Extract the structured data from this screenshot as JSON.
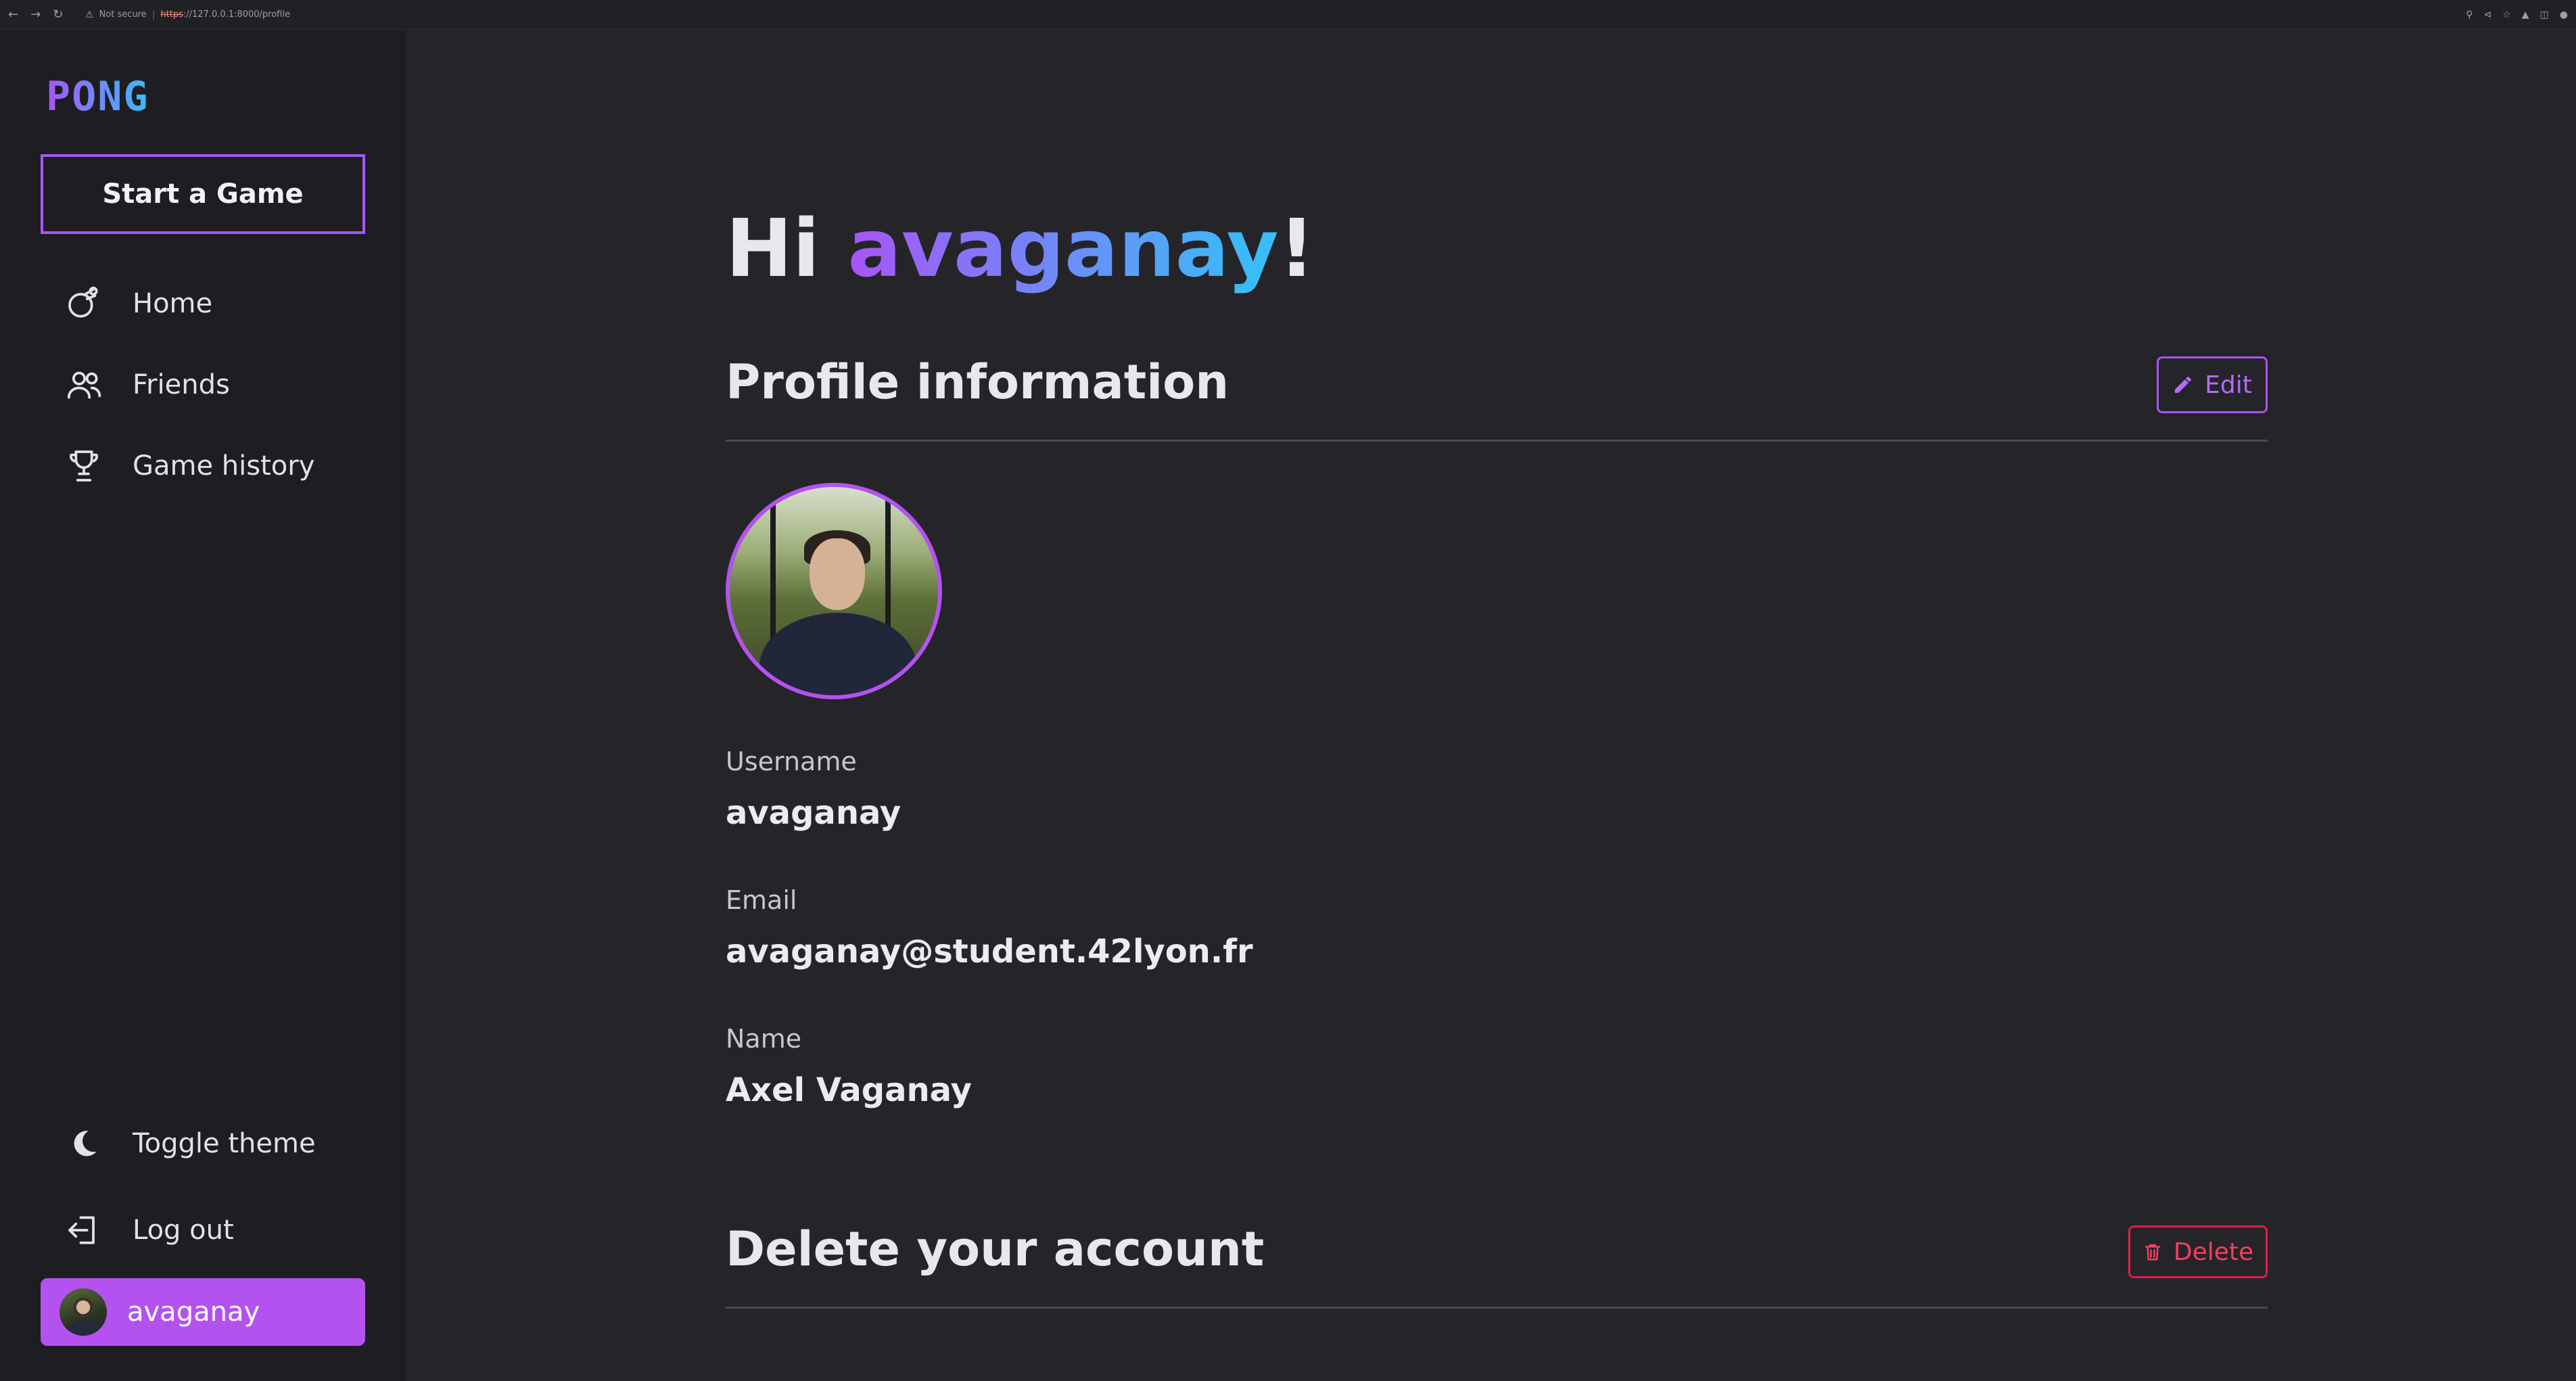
{
  "browser": {
    "security": "Not secure",
    "url_scheme": "https",
    "url_rest": "://127.0.0.1:8000/profile"
  },
  "sidebar": {
    "logo": "PONG",
    "start_button": "Start a Game",
    "items": [
      {
        "label": "Home",
        "icon": "home-icon"
      },
      {
        "label": "Friends",
        "icon": "friends-icon"
      },
      {
        "label": "Game history",
        "icon": "trophy-icon"
      }
    ],
    "toggle_theme": "Toggle theme",
    "logout": "Log out",
    "profile_name": "avaganay"
  },
  "main": {
    "greeting_prefix": "Hi ",
    "greeting_user": "avaganay",
    "greeting_suffix": "!",
    "profile_section_title": "Profile information",
    "edit_label": "Edit",
    "fields": [
      {
        "label": "Username",
        "value": "avaganay"
      },
      {
        "label": "Email",
        "value": "avaganay@student.42lyon.fr"
      },
      {
        "label": "Name",
        "value": "Axel Vaganay"
      }
    ],
    "delete_section_title": "Delete your account",
    "delete_label": "Delete"
  },
  "colors": {
    "accent": "#a855f7",
    "accent_secondary": "#38bdf8",
    "danger": "#e11d48",
    "background": "#252429",
    "sidebar": "#1e1d22"
  }
}
